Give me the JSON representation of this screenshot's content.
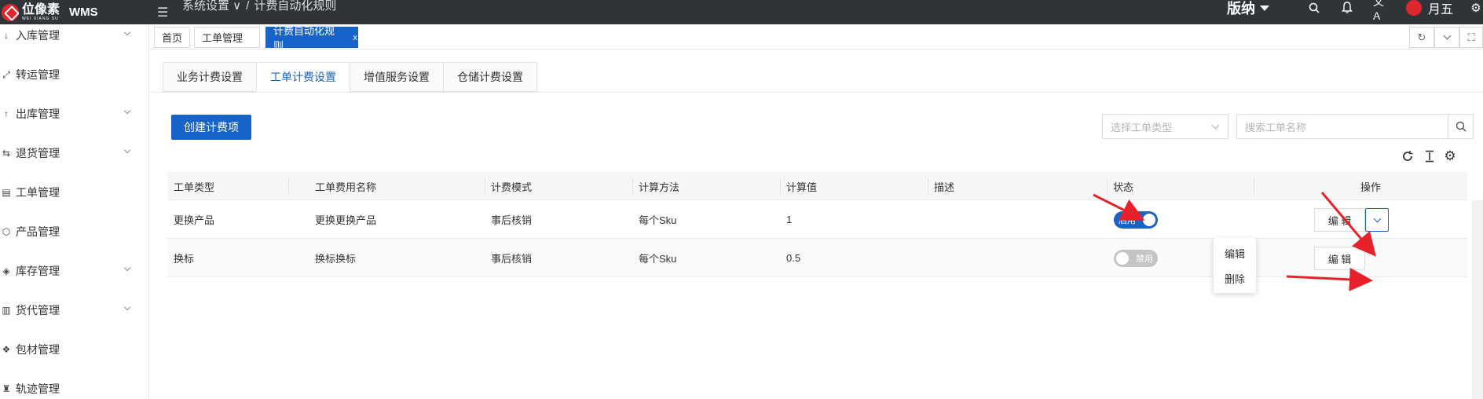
{
  "header": {
    "logo_cn": "位像素",
    "logo_en": "WEI XIANG SU",
    "app_name": "WMS",
    "breadcrumb": [
      "系统设置 ∨",
      "/",
      "计费自动化规则"
    ],
    "version_label": "版纳",
    "user_name": "月五"
  },
  "sidebar": {
    "items": [
      {
        "label": "入库管理",
        "icon": "arrow-down-icon",
        "expandable": true
      },
      {
        "label": "转运管理",
        "icon": "transfer-icon",
        "expandable": false
      },
      {
        "label": "出库管理",
        "icon": "arrow-up-icon",
        "expandable": true
      },
      {
        "label": "退货管理",
        "icon": "return-icon",
        "expandable": true
      },
      {
        "label": "工单管理",
        "icon": "workorder-icon",
        "expandable": false
      },
      {
        "label": "产品管理",
        "icon": "product-icon",
        "expandable": false
      },
      {
        "label": "库存管理",
        "icon": "inventory-icon",
        "expandable": true
      },
      {
        "label": "货代管理",
        "icon": "forwarder-icon",
        "expandable": true
      },
      {
        "label": "包材管理",
        "icon": "packaging-icon",
        "expandable": false
      },
      {
        "label": "轨迹管理",
        "icon": "track-icon",
        "expandable": false
      }
    ]
  },
  "page_tabs": [
    {
      "label": "首页",
      "active": false
    },
    {
      "label": "工单管理",
      "active": false
    },
    {
      "label": "计费自动化规则",
      "active": true,
      "close": "x"
    }
  ],
  "subtabs": [
    {
      "label": "业务计费设置",
      "active": false
    },
    {
      "label": "工单计费设置",
      "active": true
    },
    {
      "label": "增值服务设置",
      "active": false
    },
    {
      "label": "仓储计费设置",
      "active": false
    }
  ],
  "toolbar": {
    "create_label": "创建计费项",
    "type_select_placeholder": "选择工单类型",
    "search_placeholder": "搜索工单名称"
  },
  "table": {
    "columns": [
      "工单类型",
      "工单费用名称",
      "计费模式",
      "计算方法",
      "计算值",
      "描述",
      "状态",
      "操作"
    ],
    "rows": [
      {
        "type": "更换产品",
        "fee_name": "更换更换产品",
        "mode": "事后核销",
        "method": "每个Sku",
        "value": "1",
        "desc": "",
        "status_on": true,
        "status_label": "启用",
        "action": "编 辑"
      },
      {
        "type": "换标",
        "fee_name": "换标换标",
        "mode": "事后核销",
        "method": "每个Sku",
        "value": "0.5",
        "desc": "",
        "status_on": false,
        "status_label": "禁用",
        "action": "编 辑"
      }
    ]
  },
  "dropdown_menu": [
    "编辑",
    "删除"
  ],
  "colors": {
    "topbar": "#2f3439",
    "primary": "#1763c7",
    "annotation_arrow": "#e8202a"
  }
}
